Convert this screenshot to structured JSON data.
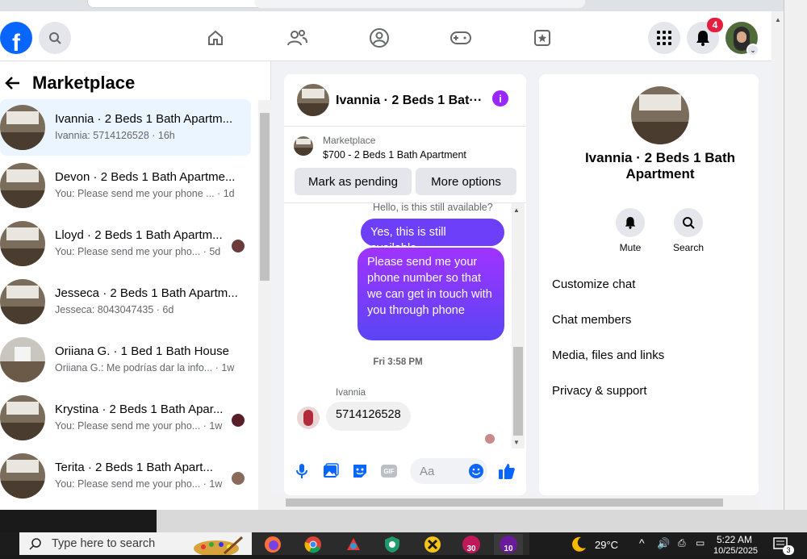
{
  "header": {
    "logo_letter": "f",
    "notification_count": "4",
    "icons": [
      "search-icon",
      "home-icon",
      "friends-icon",
      "groups-icon",
      "gaming-icon",
      "pages-icon",
      "menu-grid-icon",
      "bell-icon"
    ]
  },
  "sidebar": {
    "title": "Marketplace",
    "conversations": [
      {
        "name": "Ivannia · 2 Beds 1 Bath Apartm...",
        "preview": "Ivannia: 5714126528 · 16h"
      },
      {
        "name": "Devon · 2 Beds 1 Bath Apartme...",
        "preview": "You: Please send me your phone ... · 1d"
      },
      {
        "name": "Lloyd · 2 Beds 1 Bath Apartm...",
        "preview": "You: Please send me your pho... · 5d"
      },
      {
        "name": "Jesseca · 2 Beds 1 Bath Apartm...",
        "preview": "Jesseca: 8043047435 · 6d"
      },
      {
        "name": "Oriiana G. · 1 Bed 1 Bath House",
        "preview": "Oriiana G.: Me podrías dar la info... · 1w"
      },
      {
        "name": "Krystina · 2 Beds 1 Bath Apar...",
        "preview": "You: Please send me your pho... · 1w"
      },
      {
        "name": "Terita · 2 Beds 1 Bath Apart...",
        "preview": "You: Please send me your pho... · 1w"
      }
    ]
  },
  "chat": {
    "title": "Ivannia · 2 Beds 1 Bat···",
    "listing_source": "Marketplace",
    "listing_title": "$700 - 2 Beds 1 Bath Apartment",
    "mark_pending": "Mark as pending",
    "more_options": "More options",
    "msg_partial": "Hello, is this still available?",
    "msg_me_1": "Yes, this is still available",
    "msg_me_2": "Please send me your phone  number so that we can get in touch with you through phone",
    "timestamp": "Fri 3:58 PM",
    "sender": "Ivannia",
    "msg_them": "5714126528",
    "input_placeholder": "Aa"
  },
  "right_panel": {
    "name": "Ivannia · 2 Beds 1 Bath Apartment",
    "mute": "Mute",
    "search": "Search",
    "rows": [
      "Customize chat",
      "Chat members",
      "Media, files and links",
      "Privacy & support"
    ]
  },
  "taskbar": {
    "search_placeholder": "Type here to search",
    "temperature": "29°C",
    "time": "5:22 AM",
    "date": "10/25/2025",
    "badge_a": "30",
    "badge_b": "10",
    "notif_count": "3"
  },
  "colors": {
    "fb_blue": "#0866ff",
    "bubble_purple": "#a033ff",
    "bubble_blue": "#5a45f5",
    "active_row": "#ebf5ff"
  }
}
